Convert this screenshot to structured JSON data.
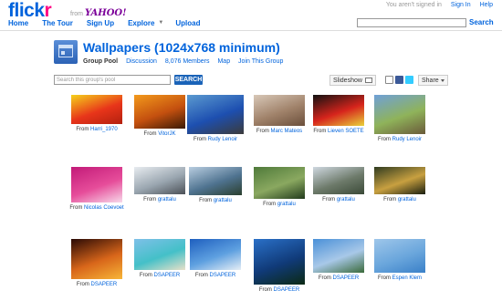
{
  "header": {
    "logo_part1": "flick",
    "logo_part2": "r",
    "from_text": "from",
    "yahoo_text": "YAHOO!",
    "signin_status": "You aren't signed in",
    "signin_link": "Sign In",
    "help_link": "Help",
    "search_button": "Search"
  },
  "nav": {
    "home": "Home",
    "tour": "The Tour",
    "signup": "Sign Up",
    "explore": "Explore",
    "upload": "Upload"
  },
  "group": {
    "title": "Wallpapers (1024x768 minimum)",
    "subnav_pool": "Group Pool",
    "subnav_discussion": "Discussion",
    "subnav_members": "8,076 Members",
    "subnav_map": "Map",
    "subnav_join": "Join This Group",
    "search_placeholder": "Search this group's pool",
    "search_button": "SEARCH",
    "slideshow": "Slideshow",
    "share": "Share"
  },
  "photos": [
    {
      "from": "From",
      "author": "Harri_1970",
      "colors": [
        "#f5d11b",
        "#e8351a",
        "#b3200f"
      ]
    },
    {
      "from": "From",
      "author": "VitorJK",
      "colors": [
        "#f39a1c",
        "#c4500f",
        "#3a1a05"
      ]
    },
    {
      "from": "From",
      "author": "Rudy Lenoir",
      "colors": [
        "#5b9ad0",
        "#1d4fb0",
        "#3b3b3b"
      ]
    },
    {
      "from": "From",
      "author": "Marc Mateos",
      "colors": [
        "#d8c8b8",
        "#a0826a",
        "#6b4f3b"
      ]
    },
    {
      "from": "From",
      "author": "Lieven SOETE",
      "colors": [
        "#111111",
        "#d6241c",
        "#e8d23a"
      ]
    },
    {
      "from": "From",
      "author": "Rudy Lenoir",
      "colors": [
        "#6fa0d8",
        "#8fb35a",
        "#6a5a3a"
      ]
    },
    {
      "from": "From",
      "author": "Nicolas Coevoet",
      "colors": [
        "#c21a78",
        "#e64d9a",
        "#f7d9ea"
      ]
    },
    {
      "from": "From",
      "author": "grattalu",
      "colors": [
        "#e8ecf0",
        "#9aa6b0",
        "#4b5056"
      ]
    },
    {
      "from": "From",
      "author": "grattalu",
      "colors": [
        "#b8cde0",
        "#4f7390",
        "#2b3f2e"
      ]
    },
    {
      "from": "From",
      "author": "grattalu",
      "colors": [
        "#4f7a3a",
        "#8aa860",
        "#223b1c"
      ]
    },
    {
      "from": "From",
      "author": "grattalu",
      "colors": [
        "#cfd8e0",
        "#6d7a6a",
        "#3b4a38"
      ]
    },
    {
      "from": "From",
      "author": "grattalu",
      "colors": [
        "#2f3b20",
        "#c8a040",
        "#1a1f10"
      ]
    },
    {
      "from": "From",
      "author": "DSAPEER",
      "colors": [
        "#2a0a05",
        "#d8661a",
        "#f7b638"
      ]
    },
    {
      "from": "From",
      "author": "DSAPEER",
      "colors": [
        "#7ec0e8",
        "#44c0c8",
        "#e8e0c8"
      ]
    },
    {
      "from": "From",
      "author": "DSAPEER",
      "colors": [
        "#1e5fbf",
        "#5ea0e0",
        "#e6eef5"
      ]
    },
    {
      "from": "From",
      "author": "DSAPEER",
      "colors": [
        "#2a70c8",
        "#103a78",
        "#0b2a14"
      ]
    },
    {
      "from": "From",
      "author": "DSAPEER",
      "colors": [
        "#4a90d8",
        "#a8c8e8",
        "#3a6a3a"
      ]
    },
    {
      "from": "From",
      "author": "Espen Klem",
      "colors": [
        "#9ec6ea",
        "#6aa6dc",
        "#3a80c8"
      ]
    }
  ]
}
